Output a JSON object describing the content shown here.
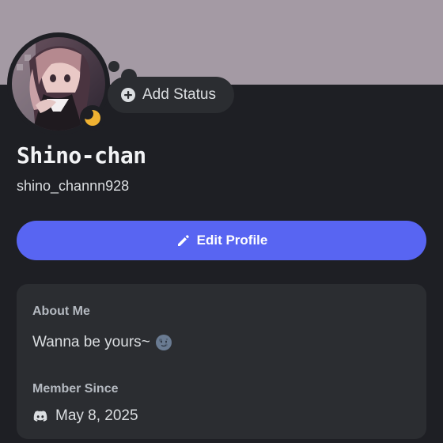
{
  "profile": {
    "display_name": "Shino-chan",
    "username": "shino_channn928",
    "status_badge_icon": "crescent-moon-icon",
    "avatar_icon": "anime-avatar-image"
  },
  "status": {
    "add_label": "Add Status",
    "icon": "plus-circle-icon"
  },
  "actions": {
    "edit_profile_label": "Edit Profile",
    "edit_icon": "pencil-icon"
  },
  "about": {
    "title": "About Me",
    "text": "Wanna be yours~",
    "emoji_icon": "new-moon-face-icon"
  },
  "member_since": {
    "title": "Member Since",
    "date": "May 8, 2025",
    "icon": "discord-logo-icon"
  },
  "colors": {
    "banner": "#a49aa4",
    "background": "#1e1f24",
    "card": "#2b2d31",
    "accent": "#5865f2",
    "idle_status": "#f0b232"
  }
}
